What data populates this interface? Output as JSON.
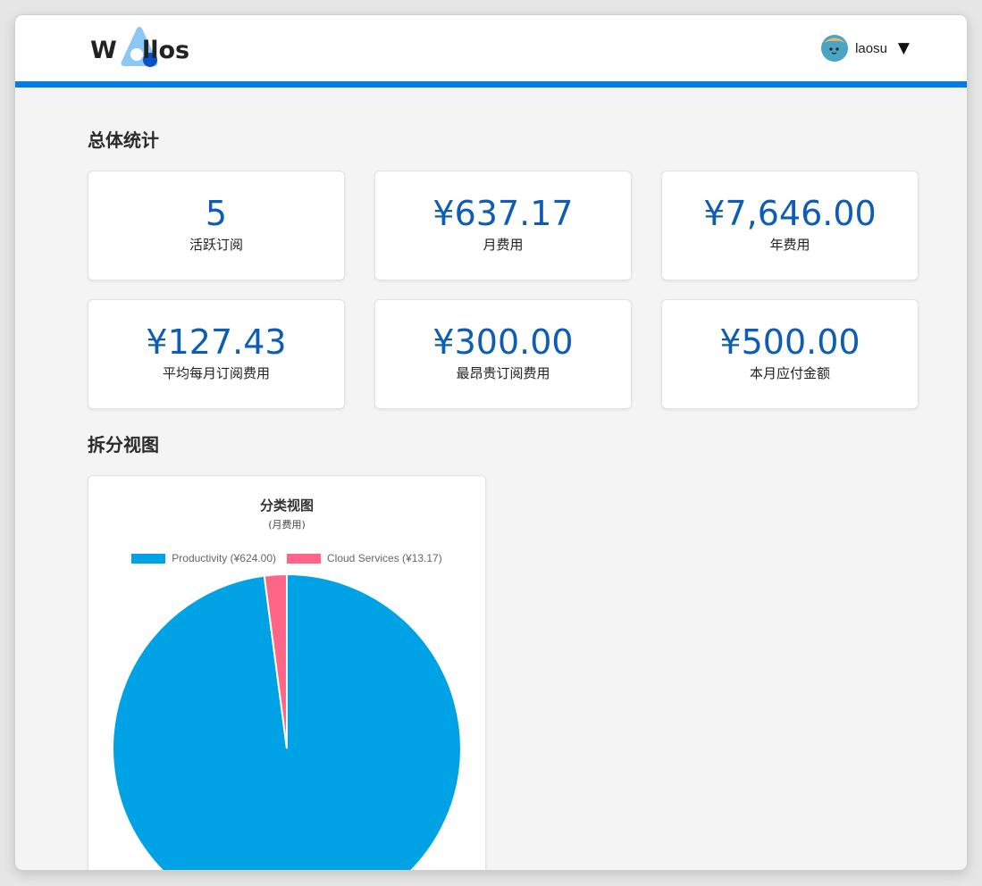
{
  "header": {
    "logo_w": "W",
    "logo_rest": "llos",
    "username": "laosu",
    "caret": "▼"
  },
  "overall": {
    "title": "总体统计",
    "cards": [
      {
        "value": "5",
        "label": "活跃订阅"
      },
      {
        "value": "¥637.17",
        "label": "月费用"
      },
      {
        "value": "¥7,646.00",
        "label": "年费用"
      },
      {
        "value": "¥127.43",
        "label": "平均每月订阅费用"
      },
      {
        "value": "¥300.00",
        "label": "最昂贵订阅费用"
      },
      {
        "value": "¥500.00",
        "label": "本月应付金额"
      }
    ]
  },
  "split": {
    "title": "拆分视图"
  },
  "colors": {
    "accent": "#007bf0",
    "value_text": "#0d5cb6",
    "productivity": "#00a2e6",
    "cloud": "#ff6586"
  },
  "chart_data": {
    "type": "pie",
    "title": "分类视图",
    "subtitle": "(月费用)",
    "legend_position": "top",
    "categories": [
      "Productivity (¥624.00)",
      "Cloud Services (¥13.17)"
    ],
    "values": [
      624.0,
      13.17
    ],
    "colors": [
      "#00a2e6",
      "#ff6586"
    ]
  }
}
